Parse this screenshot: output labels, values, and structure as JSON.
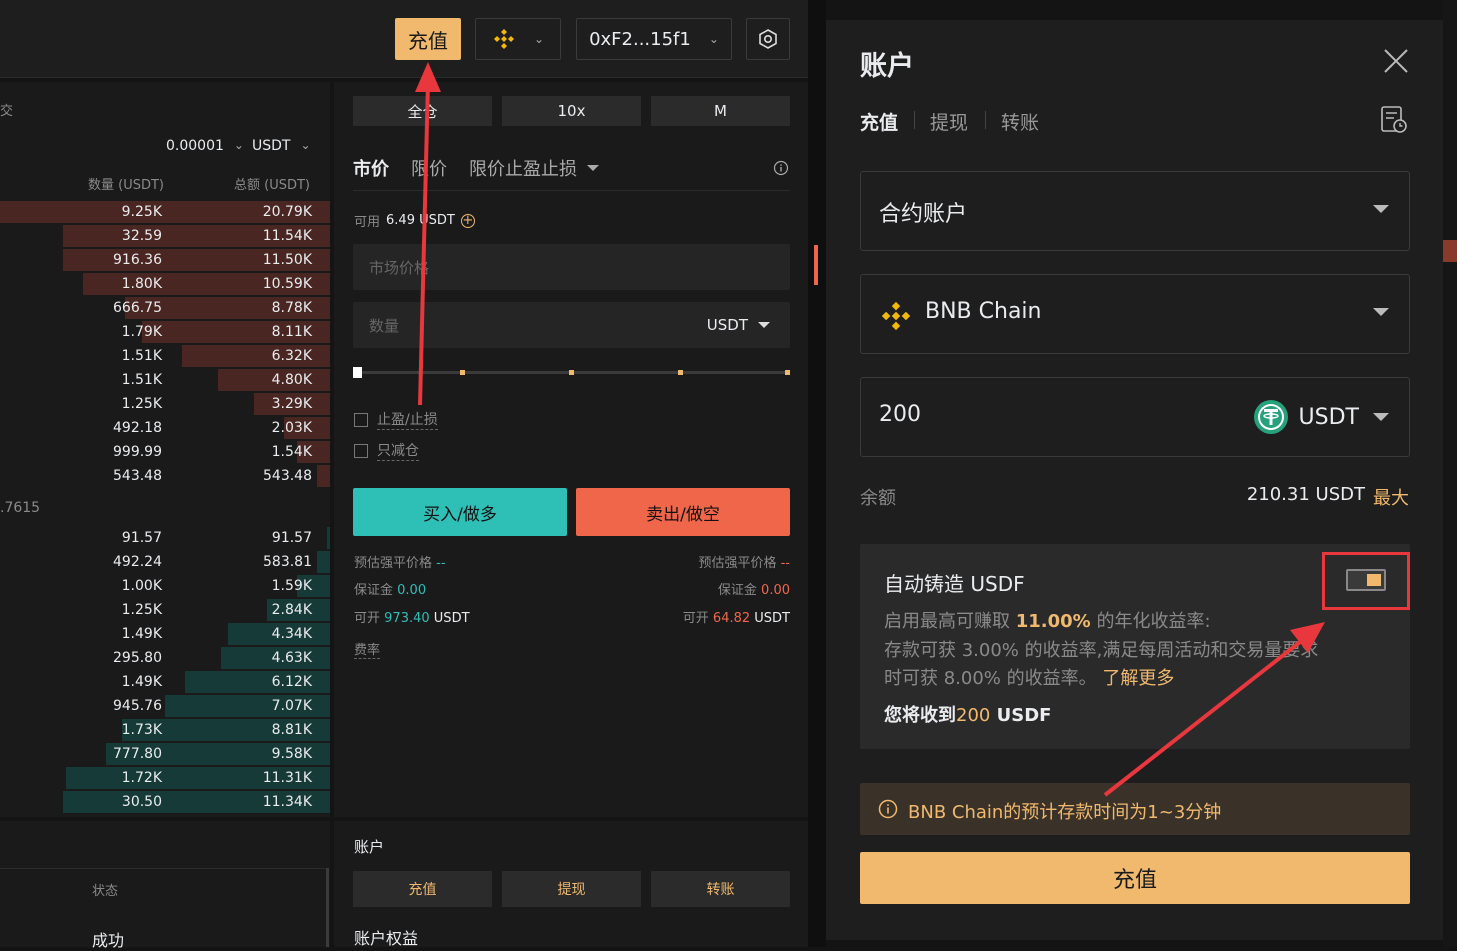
{
  "header": {
    "deposit_label": "充值",
    "wallet_label": "0xF2...15f1"
  },
  "orderbook": {
    "cut_label": "交",
    "precision": "0.00001",
    "unit": "USDT",
    "col_qty": "数量 (USDT)",
    "col_total": "总额 (USDT)",
    "asks": [
      {
        "q": "9.25K",
        "t": "20.79K",
        "w": 1.0
      },
      {
        "q": "32.59",
        "t": "11.54K",
        "w": 0.81
      },
      {
        "q": "916.36",
        "t": "11.50K",
        "w": 0.81
      },
      {
        "q": "1.80K",
        "t": "10.59K",
        "w": 0.75
      },
      {
        "q": "666.75",
        "t": "8.78K",
        "w": 0.62
      },
      {
        "q": "1.79K",
        "t": "8.11K",
        "w": 0.57
      },
      {
        "q": "1.51K",
        "t": "6.32K",
        "w": 0.45
      },
      {
        "q": "1.51K",
        "t": "4.80K",
        "w": 0.34
      },
      {
        "q": "1.25K",
        "t": "3.29K",
        "w": 0.23
      },
      {
        "q": "492.18",
        "t": "2.03K",
        "w": 0.14
      },
      {
        "q": "999.99",
        "t": "1.54K",
        "w": 0.1
      },
      {
        "q": "543.48",
        "t": "543.48",
        "w": 0.04
      }
    ],
    "mid_price": ".7615",
    "bids": [
      {
        "q": "91.57",
        "t": "91.57",
        "w": 0.01
      },
      {
        "q": "492.24",
        "t": "583.81",
        "w": 0.04
      },
      {
        "q": "1.00K",
        "t": "1.59K",
        "w": 0.1
      },
      {
        "q": "1.25K",
        "t": "2.84K",
        "w": 0.19
      },
      {
        "q": "1.49K",
        "t": "4.34K",
        "w": 0.31
      },
      {
        "q": "295.80",
        "t": "4.63K",
        "w": 0.33
      },
      {
        "q": "1.49K",
        "t": "6.12K",
        "w": 0.44
      },
      {
        "q": "945.76",
        "t": "7.07K",
        "w": 0.5
      },
      {
        "q": "1.73K",
        "t": "8.81K",
        "w": 0.63
      },
      {
        "q": "777.80",
        "t": "9.58K",
        "w": 0.68
      },
      {
        "q": "1.72K",
        "t": "11.31K",
        "w": 0.8
      },
      {
        "q": "30.50",
        "t": "11.34K",
        "w": 0.81
      }
    ]
  },
  "form": {
    "margin_mode": "全仓",
    "leverage": "10x",
    "mode_m": "M",
    "tab_market": "市价",
    "tab_limit": "限价",
    "tab_tpsl": "限价止盈止损",
    "available_label": "可用",
    "available_value": "6.49 USDT",
    "price_placeholder": "市场价格",
    "qty_placeholder": "数量",
    "qty_unit": "USDT",
    "tpsl_label": "止盈/止损",
    "reduce_label": "只减仓",
    "buy_label": "买入/做多",
    "sell_label": "卖出/做空",
    "liq_label": "预估强平价格",
    "liq_value": "--",
    "margin_label": "保证金",
    "margin_value": "0.00",
    "open_label": "可开",
    "buy_open_value": "973.40",
    "sell_open_value": "64.82",
    "open_unit": "USDT",
    "fee_label": "费率"
  },
  "bottom_left": {
    "status_header": "状态",
    "status_value": "成功"
  },
  "bottom_right": {
    "title": "账户",
    "deposit": "充值",
    "withdraw": "提现",
    "transfer": "转账",
    "equity_label": "账户权益"
  },
  "modal": {
    "title": "账户",
    "tab_deposit": "充值",
    "tab_withdraw": "提现",
    "tab_transfer": "转账",
    "account_select": "合约账户",
    "chain_select": "BNB Chain",
    "amount_value": "200",
    "token_select": "USDT",
    "balance_label": "余额",
    "balance_value": "210.31 USDT",
    "max_label": "最大",
    "card_title": "自动铸造 USDF",
    "card_line1_a": "启用最高可赚取 ",
    "card_line1_rate": "11.00%",
    "card_line1_b": " 的年化收益率:",
    "card_line2": "存款可获 3.00% 的收益率,满足每周活动和交易量要求",
    "card_line3": "时可获 8.00% 的收益率。",
    "learn_more": "了解更多",
    "receive_a": "您将收到",
    "receive_amount": "200",
    "receive_unit": " USDF",
    "notice_text": "BNB Chain的预计存款时间为1~3分钟",
    "deposit_button": "充值"
  },
  "colors": {
    "accent": "#f0b96e",
    "buy": "#2ebfb7",
    "sell": "#f0664a",
    "highlight": "#e8373d"
  }
}
